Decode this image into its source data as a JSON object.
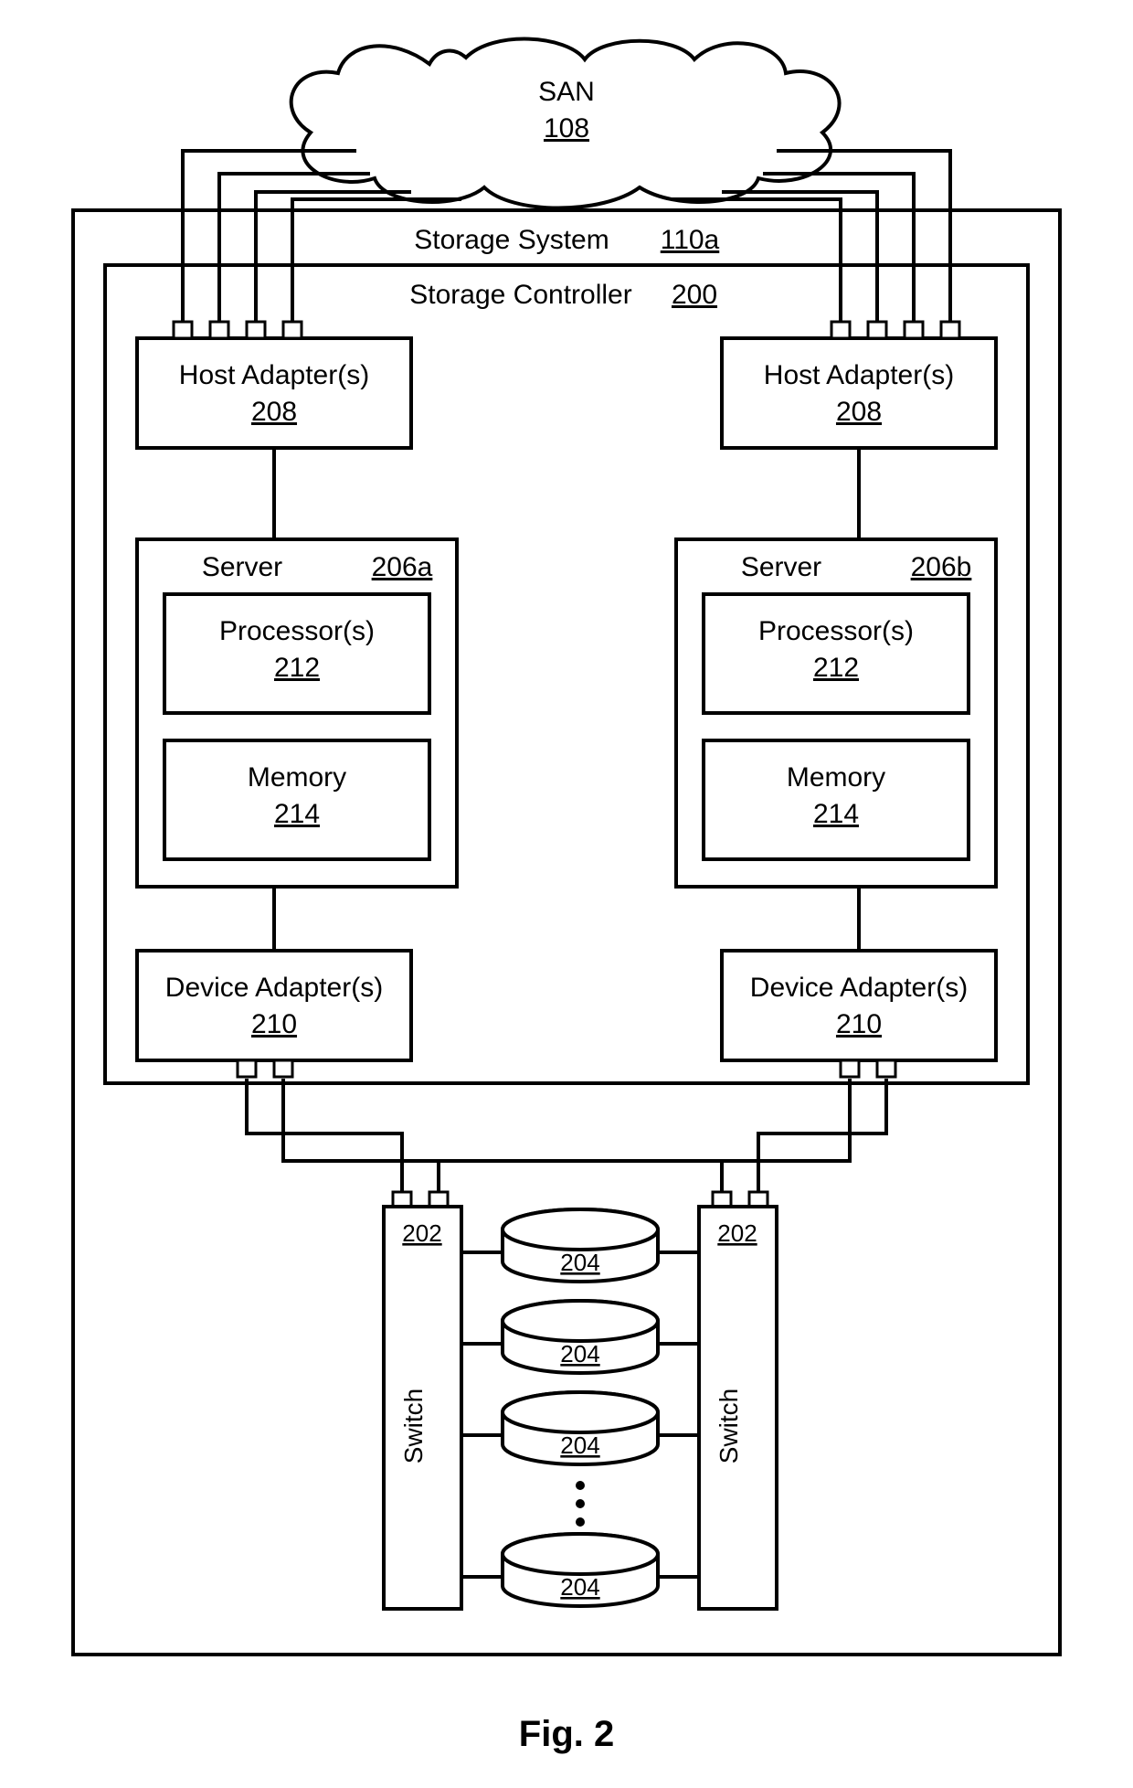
{
  "san": {
    "label": "SAN",
    "ref": "108"
  },
  "storage_system": {
    "label": "Storage System",
    "ref": "110a"
  },
  "storage_controller": {
    "label": "Storage Controller",
    "ref": "200"
  },
  "left": {
    "host_adapter": {
      "label": "Host Adapter(s)",
      "ref": "208"
    },
    "server": {
      "label": "Server",
      "ref": "206a"
    },
    "processor": {
      "label": "Processor(s)",
      "ref": "212"
    },
    "memory": {
      "label": "Memory",
      "ref": "214"
    },
    "device_adapter": {
      "label": "Device Adapter(s)",
      "ref": "210"
    }
  },
  "right": {
    "host_adapter": {
      "label": "Host Adapter(s)",
      "ref": "208"
    },
    "server": {
      "label": "Server",
      "ref": "206b"
    },
    "processor": {
      "label": "Processor(s)",
      "ref": "212"
    },
    "memory": {
      "label": "Memory",
      "ref": "214"
    },
    "device_adapter": {
      "label": "Device Adapter(s)",
      "ref": "210"
    }
  },
  "switches": [
    {
      "label": "Switch",
      "ref": "202"
    },
    {
      "label": "Switch",
      "ref": "202"
    }
  ],
  "disks": [
    {
      "ref": "204"
    },
    {
      "ref": "204"
    },
    {
      "ref": "204"
    },
    {
      "ref": "204"
    }
  ],
  "figure": {
    "label": "Fig. 2"
  }
}
